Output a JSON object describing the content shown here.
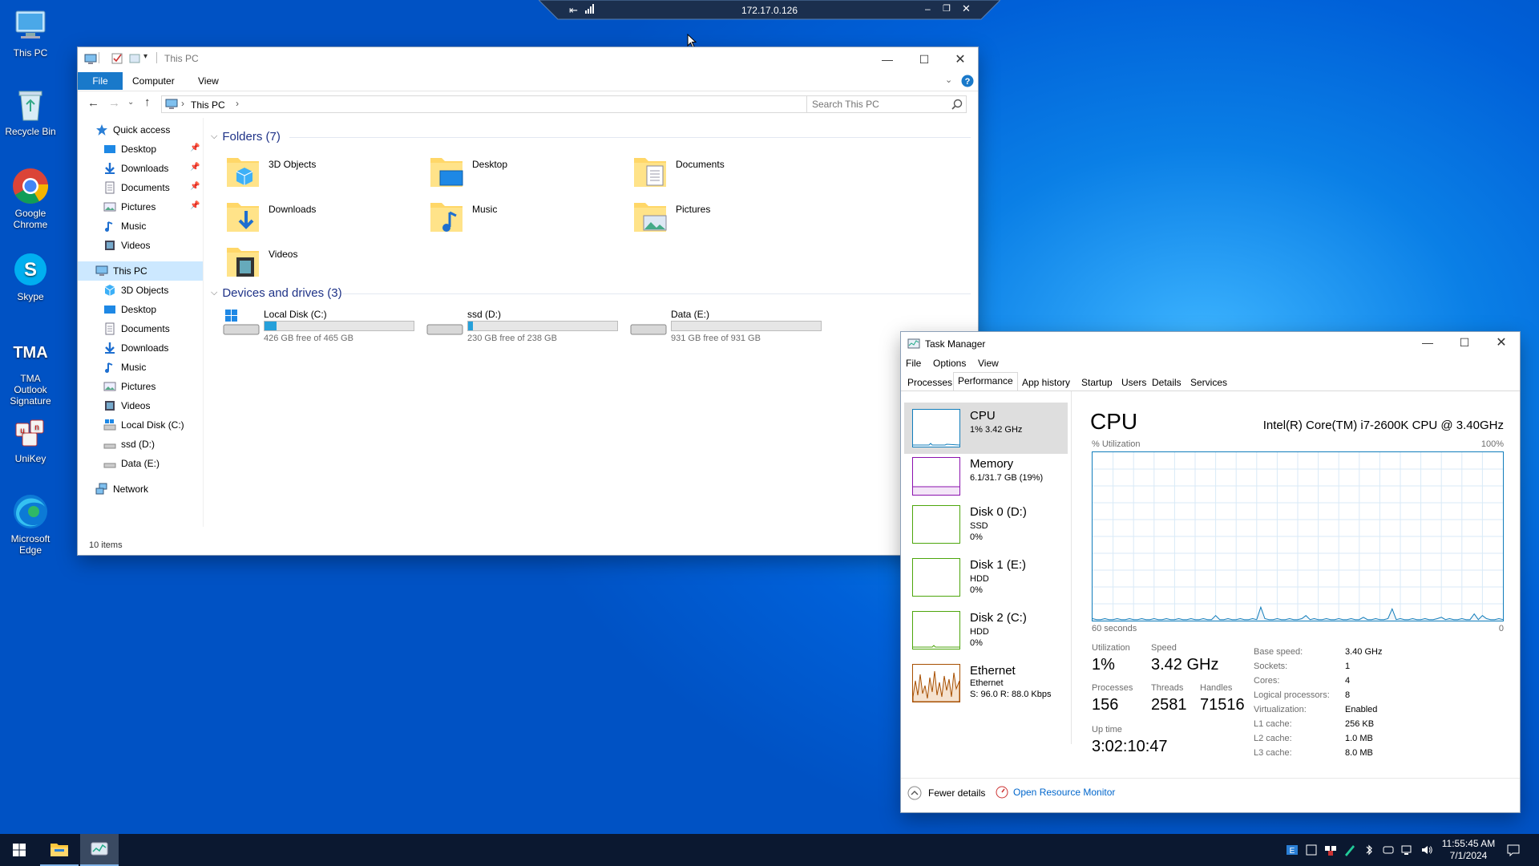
{
  "desktop": {
    "icons": [
      {
        "label": "This PC",
        "icon": "this-pc-icon"
      },
      {
        "label": "Recycle Bin",
        "icon": "recycle-bin-icon"
      },
      {
        "label": "Google Chrome",
        "icon": "chrome-icon"
      },
      {
        "label": "Skype",
        "icon": "skype-icon"
      },
      {
        "label": "TMA Outlook Signature",
        "icon": "tma-icon"
      },
      {
        "label": "UniKey",
        "icon": "unikey-icon"
      },
      {
        "label": "Microsoft Edge",
        "icon": "edge-icon"
      }
    ]
  },
  "rdp_bar": {
    "host": "172.17.0.126"
  },
  "explorer": {
    "title": "This PC",
    "ribbon_tabs": [
      "File",
      "Computer",
      "View"
    ],
    "address": "This PC",
    "search_placeholder": "Search This PC",
    "nav": {
      "quick_access": "Quick access",
      "quick_items": [
        "Desktop",
        "Downloads",
        "Documents",
        "Pictures",
        "Music",
        "Videos"
      ],
      "this_pc": "This PC",
      "pc_items": [
        "3D Objects",
        "Desktop",
        "Documents",
        "Downloads",
        "Music",
        "Pictures",
        "Videos",
        "Local Disk (C:)",
        "ssd (D:)",
        "Data (E:)"
      ],
      "network": "Network"
    },
    "folders_header": "Folders (7)",
    "folders": [
      "3D Objects",
      "Desktop",
      "Documents",
      "Downloads",
      "Music",
      "Pictures",
      "Videos"
    ],
    "drives_header": "Devices and drives (3)",
    "drives": [
      {
        "name": "Local Disk (C:)",
        "free": "426 GB free of 465 GB",
        "used_fraction": 0.08
      },
      {
        "name": "ssd (D:)",
        "free": "230 GB free of 238 GB",
        "used_fraction": 0.03
      },
      {
        "name": "Data (E:)",
        "free": "931 GB free of 931 GB",
        "used_fraction": 0.0
      }
    ],
    "status": "10 items"
  },
  "taskmgr": {
    "title": "Task Manager",
    "menu": [
      "File",
      "Options",
      "View"
    ],
    "tabs": [
      "Processes",
      "Performance",
      "App history",
      "Startup",
      "Users",
      "Details",
      "Services"
    ],
    "active_tab": "Performance",
    "resources": [
      {
        "name": "CPU",
        "l1": "1% 3.42 GHz",
        "l2": "",
        "color": "#117dbb"
      },
      {
        "name": "Memory",
        "l1": "6.1/31.7 GB (19%)",
        "l2": "",
        "color": "#8b12ae"
      },
      {
        "name": "Disk 0 (D:)",
        "l1": "SSD",
        "l2": "0%",
        "color": "#4da60c"
      },
      {
        "name": "Disk 1 (E:)",
        "l1": "HDD",
        "l2": "0%",
        "color": "#4da60c"
      },
      {
        "name": "Disk 2 (C:)",
        "l1": "HDD",
        "l2": "0%",
        "color": "#4da60c"
      },
      {
        "name": "Ethernet",
        "l1": "Ethernet",
        "l2": "S: 96.0  R: 88.0 Kbps",
        "color": "#a74f01"
      }
    ],
    "cpu": {
      "heading": "CPU",
      "model": "Intel(R) Core(TM) i7-2600K CPU @ 3.40GHz",
      "util_label": "% Utilization",
      "max_label": "100%",
      "time_label": "60 seconds",
      "zero_label": "0",
      "stats": {
        "utilization_label": "Utilization",
        "utilization": "1%",
        "speed_label": "Speed",
        "speed": "3.42 GHz",
        "processes_label": "Processes",
        "processes": "156",
        "threads_label": "Threads",
        "threads": "2581",
        "handles_label": "Handles",
        "handles": "71516",
        "uptime_label": "Up time",
        "uptime": "3:02:10:47"
      },
      "specs": [
        {
          "k": "Base speed:",
          "v": "3.40 GHz"
        },
        {
          "k": "Sockets:",
          "v": "1"
        },
        {
          "k": "Cores:",
          "v": "4"
        },
        {
          "k": "Logical processors:",
          "v": "8"
        },
        {
          "k": "Virtualization:",
          "v": "Enabled"
        },
        {
          "k": "L1 cache:",
          "v": "256 KB"
        },
        {
          "k": "L2 cache:",
          "v": "1.0 MB"
        },
        {
          "k": "L3 cache:",
          "v": "8.0 MB"
        }
      ]
    },
    "fewer_details": "Fewer details",
    "open_monitor": "Open Resource Monitor"
  },
  "taskbar": {
    "time": "11:55:45 AM",
    "date": "7/1/2024"
  }
}
